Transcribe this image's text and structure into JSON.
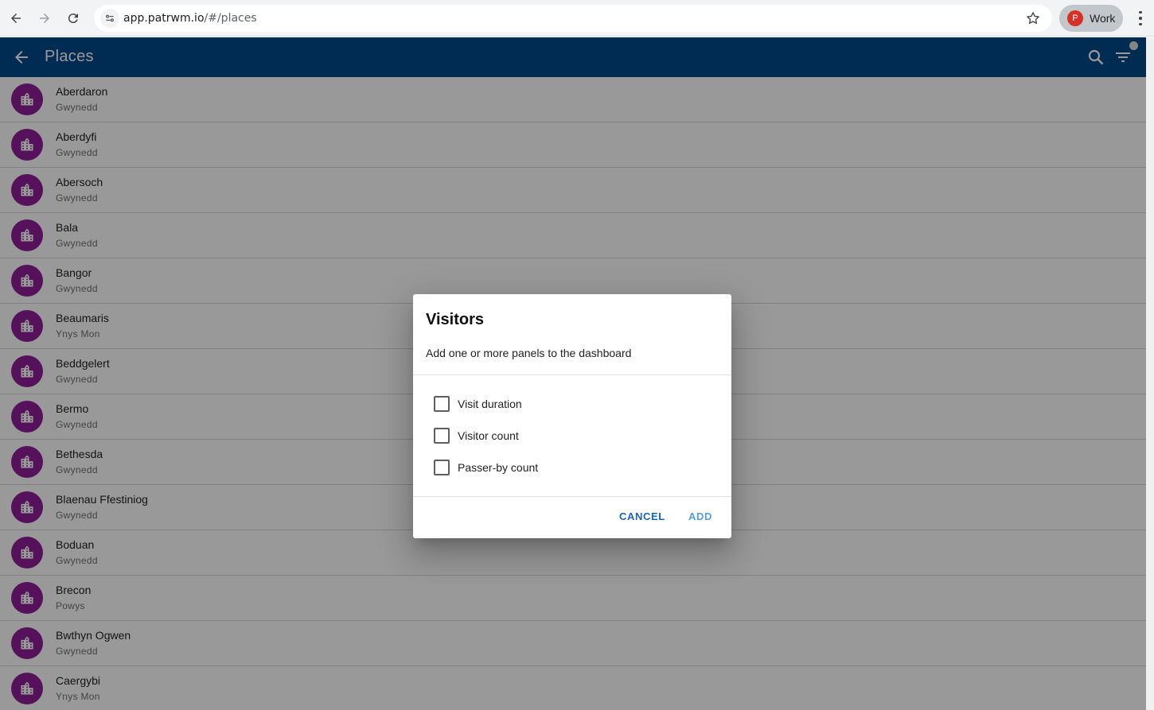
{
  "browser": {
    "url_host": "app.patrwm.io",
    "url_path": "/#/places",
    "profile_initial": "P",
    "profile_name": "Work"
  },
  "app_bar": {
    "title": "Places",
    "color": "#004a8c"
  },
  "places": [
    {
      "name": "Aberdaron",
      "region": "Gwynedd"
    },
    {
      "name": "Aberdyfi",
      "region": "Gwynedd"
    },
    {
      "name": "Abersoch",
      "region": "Gwynedd"
    },
    {
      "name": "Bala",
      "region": "Gwynedd"
    },
    {
      "name": "Bangor",
      "region": "Gwynedd"
    },
    {
      "name": "Beaumaris",
      "region": "Ynys Mon"
    },
    {
      "name": "Beddgelert",
      "region": "Gwynedd"
    },
    {
      "name": "Bermo",
      "region": "Gwynedd"
    },
    {
      "name": "Bethesda",
      "region": "Gwynedd"
    },
    {
      "name": "Blaenau Ffestiniog",
      "region": "Gwynedd"
    },
    {
      "name": "Boduan",
      "region": "Gwynedd"
    },
    {
      "name": "Brecon",
      "region": "Powys"
    },
    {
      "name": "Bwthyn Ogwen",
      "region": "Gwynedd"
    },
    {
      "name": "Caergybi",
      "region": "Ynys Mon"
    }
  ],
  "dialog": {
    "title": "Visitors",
    "subtitle": "Add one or more panels to the dashboard",
    "options": [
      {
        "label": "Visit duration",
        "checked": false
      },
      {
        "label": "Visitor count",
        "checked": false
      },
      {
        "label": "Passer-by count",
        "checked": false
      }
    ],
    "cancel_label": "CANCEL",
    "add_label": "ADD"
  },
  "colors": {
    "avatar": "#8e1f98",
    "primary_button": "#1565c0"
  }
}
